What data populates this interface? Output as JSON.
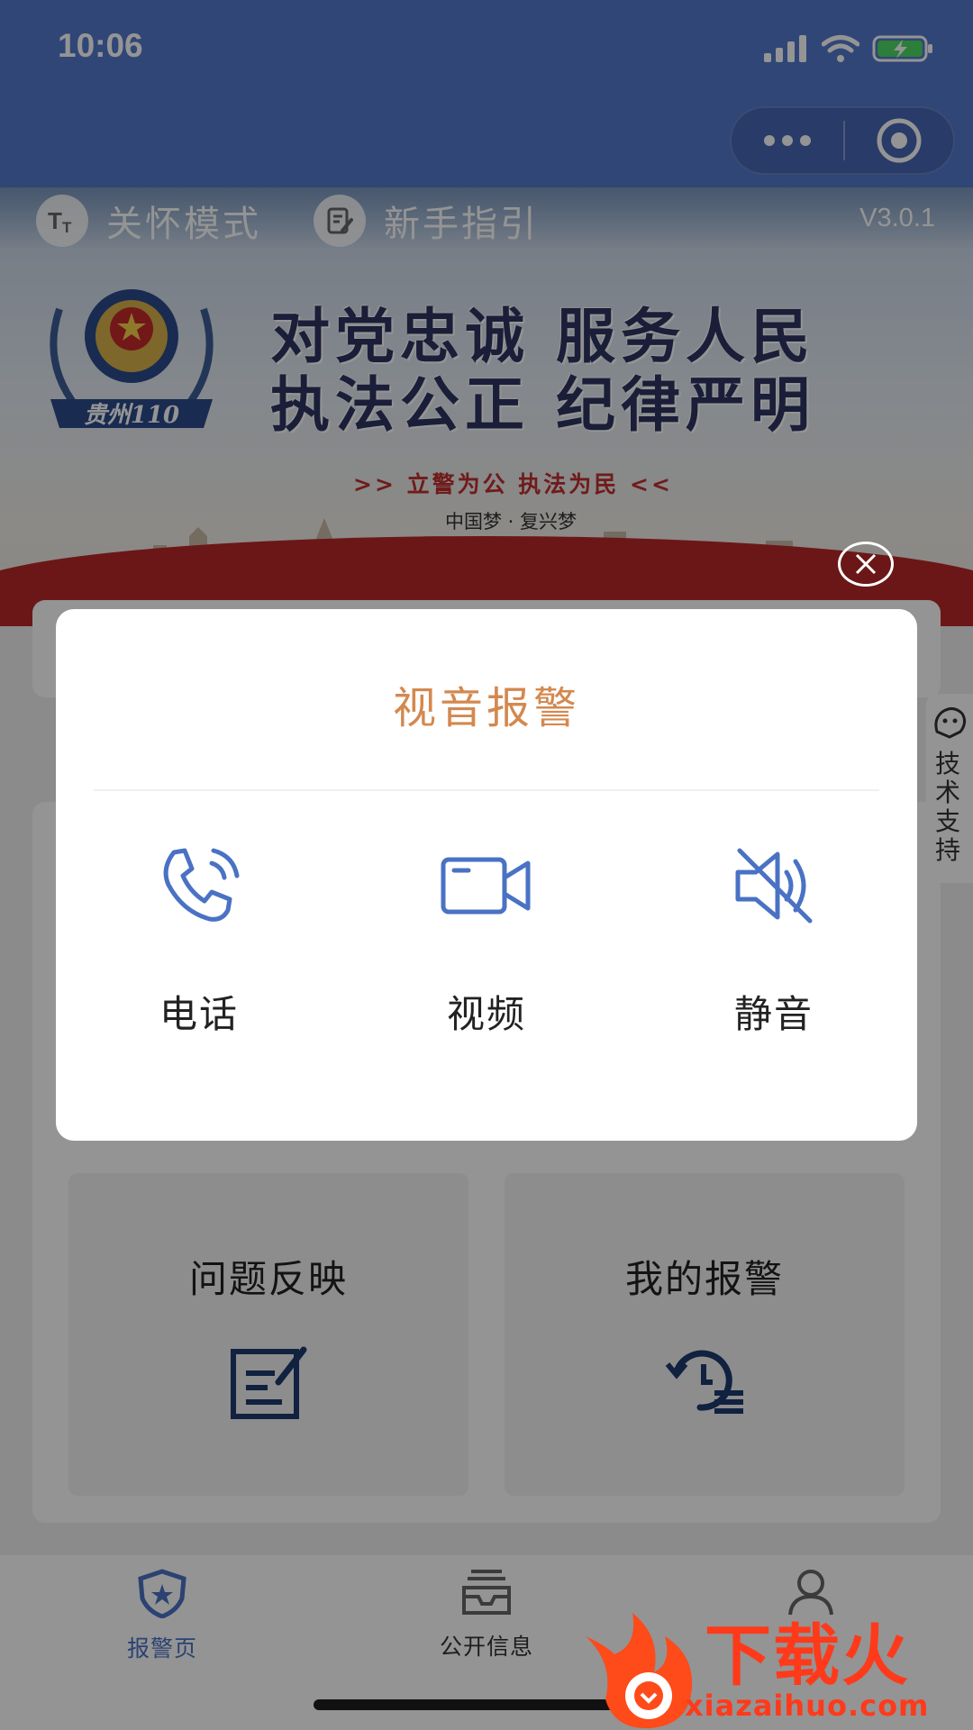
{
  "status_bar": {
    "time": "10:06"
  },
  "capsule": {
    "more_icon": "more-dots-icon",
    "close_icon": "target-icon"
  },
  "banner": {
    "care_mode_label": "关怀模式",
    "guide_label": "新手指引",
    "version": "V3.0.1",
    "emblem_text": "贵州110",
    "slogan_line1": "对党忠诚  服务人民",
    "slogan_line2": "执法公正  纪律严明",
    "motto": ">>  立警为公  执法为民  <<",
    "dream": "中国梦 · 复兴梦"
  },
  "tiles": [
    {
      "title": "问题反映",
      "icon": "edit-note-icon"
    },
    {
      "title": "我的报警",
      "icon": "history-list-icon"
    }
  ],
  "side_support": {
    "label": "技术支持",
    "icon": "support-chat-icon"
  },
  "modal": {
    "title": "视音报警",
    "options": [
      {
        "label": "电话",
        "icon": "phone-call-icon"
      },
      {
        "label": "视频",
        "icon": "video-camera-icon"
      },
      {
        "label": "静音",
        "icon": "mute-icon"
      }
    ]
  },
  "tabbar": {
    "tabs": [
      {
        "label": "报警页",
        "icon": "police-shield-icon",
        "active": true
      },
      {
        "label": "公开信息",
        "icon": "inbox-icon",
        "active": false
      },
      {
        "label": "",
        "icon": "user-icon",
        "active": false
      }
    ]
  },
  "watermark": {
    "brand": "下载火",
    "url": "xiazaihuo.com"
  },
  "colors": {
    "nav_blue": "#5379cd",
    "accent_orange": "#d4884f",
    "icon_blue": "#4a72c4",
    "tile_icon_navy": "#1e3a6e",
    "watermark_red": "#ff3a1a"
  }
}
